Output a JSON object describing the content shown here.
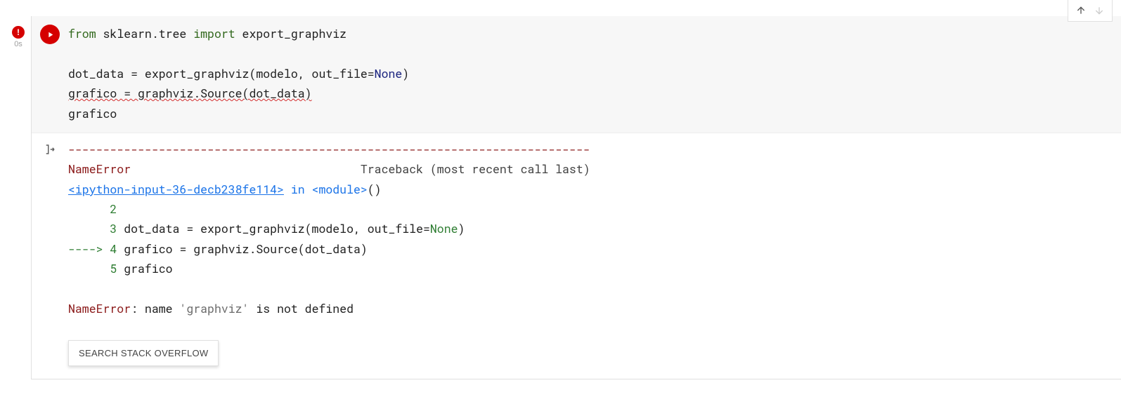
{
  "topbar": {
    "nav_up_title": "Previous cell",
    "nav_down_title": "Next cell"
  },
  "gutter": {
    "error_glyph": "!",
    "exec_time": "0s"
  },
  "run": {
    "title": "Run cell"
  },
  "code": {
    "kw_from": "from",
    "mod": " sklearn.tree ",
    "kw_import": "import",
    "imp_name": " export_graphviz",
    "line3_a": "dot_data = export_graphviz(modelo, out_file=",
    "kw_none": "None",
    "line3_b": ")",
    "line4": "grafico = graphviz.Source(dot_data)",
    "line5": "grafico"
  },
  "output": {
    "indicator_glyph": "[→",
    "separator": "---------------------------------------------------------------------------",
    "err_name": "NameError",
    "traceback_label": "                                 Traceback (most recent call last)",
    "frame_link": "<ipython-input-36-decb238fe114>",
    "in_word": " in ",
    "in_module": "<module>",
    "parens": "()",
    "ln2_num": "      2",
    "ln2_text": " ",
    "ln3_num": "      3",
    "ln3_text": " dot_data = export_graphviz(modelo, out_file=",
    "ln3_none": "None",
    "ln3_close": ")",
    "ln4_arrow": "----> ",
    "ln4_num": "4",
    "ln4_text": " grafico = graphviz.Source(dot_data)",
    "ln5_num": "      5",
    "ln5_text": " grafico",
    "final_name": "NameError",
    "final_msg": ": name ",
    "final_str": "'graphviz'",
    "final_msg2": " is not defined",
    "so_button": "SEARCH STACK OVERFLOW"
  }
}
